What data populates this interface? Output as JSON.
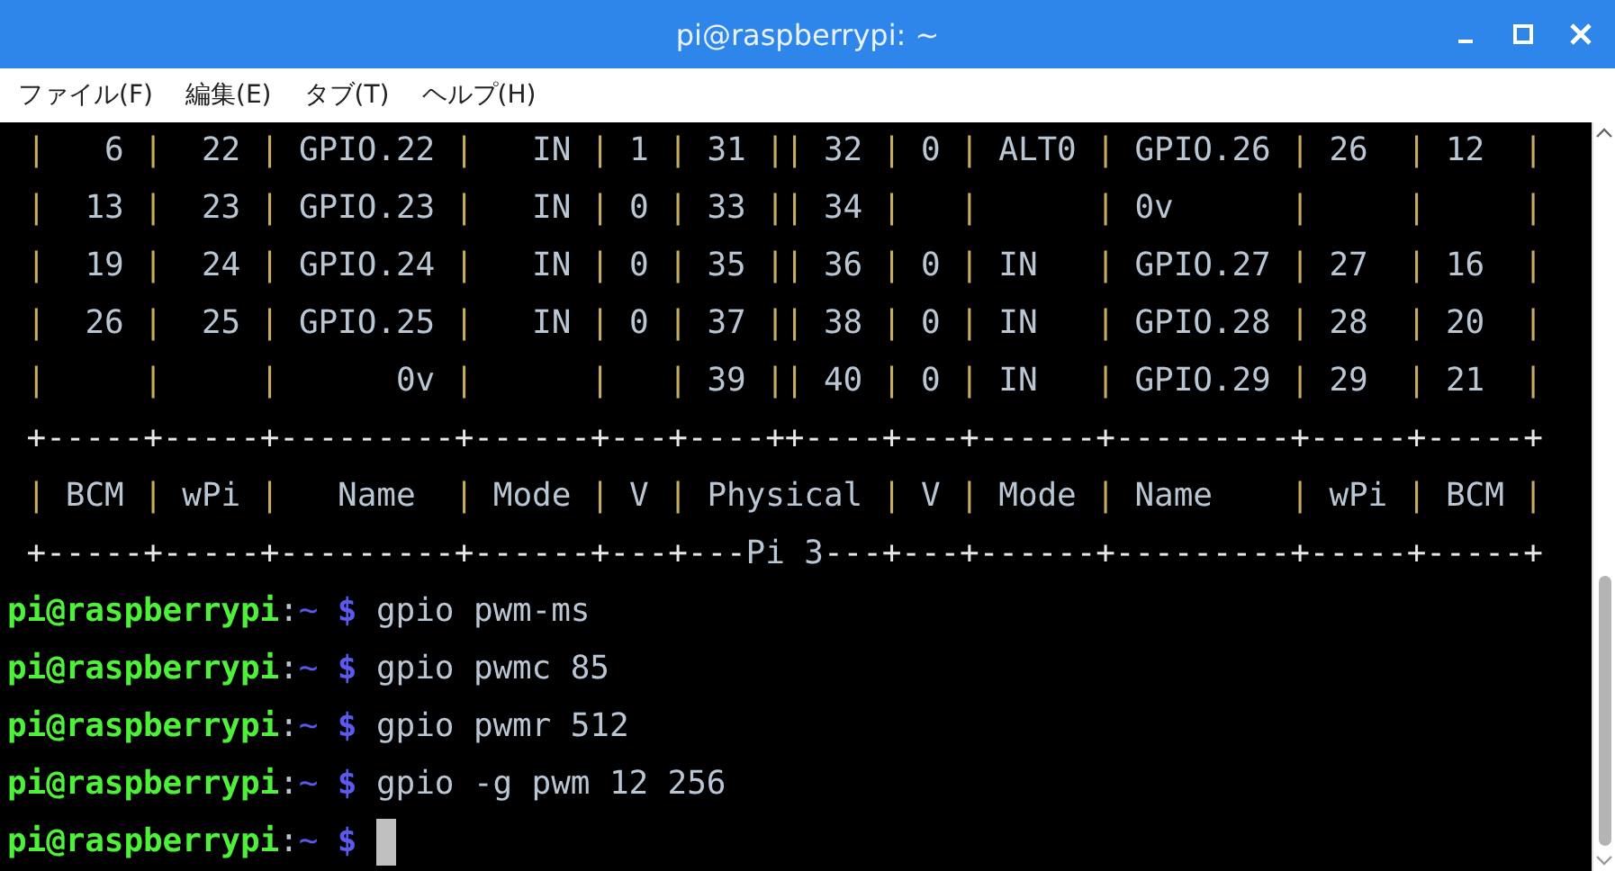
{
  "window": {
    "title": "pi@raspberrypi: ~"
  },
  "menu": [
    "ファイル(F)",
    "編集(E)",
    "タブ(T)",
    "ヘルプ(H)"
  ],
  "terminal": {
    "lines": [
      {
        "kind": "table",
        "text": " |   6 |  22 | GPIO.22 |   IN | 1 | 31 || 32 | 0 | ALT0 | GPIO.26 | 26  | 12  |"
      },
      {
        "kind": "table",
        "text": " |  13 |  23 | GPIO.23 |   IN | 0 | 33 || 34 |   |      | 0v      |     |     |"
      },
      {
        "kind": "table",
        "text": " |  19 |  24 | GPIO.24 |   IN | 0 | 35 || 36 | 0 | IN   | GPIO.27 | 27  | 16  |"
      },
      {
        "kind": "table",
        "text": " |  26 |  25 | GPIO.25 |   IN | 0 | 37 || 38 | 0 | IN   | GPIO.28 | 28  | 20  |"
      },
      {
        "kind": "table",
        "text": " |     |     |      0v |      |   | 39 || 40 | 0 | IN   | GPIO.29 | 29  | 21  |"
      },
      {
        "kind": "table",
        "text": " +-----+-----+---------+------+---+----++----+---+------+---------+-----+-----+"
      },
      {
        "kind": "table",
        "text": " | BCM | wPi |   Name  | Mode | V | Physical | V | Mode | Name    | wPi | BCM |"
      },
      {
        "kind": "table",
        "text": " +-----+-----+---------+------+---+---Pi 3---+---+------+---------+-----+-----+"
      },
      {
        "kind": "prompt",
        "user": "pi@raspberrypi",
        "sep": ":",
        "path": "~",
        "symbol": "$",
        "command": "gpio pwm-ms"
      },
      {
        "kind": "prompt",
        "user": "pi@raspberrypi",
        "sep": ":",
        "path": "~",
        "symbol": "$",
        "command": "gpio pwmc 85"
      },
      {
        "kind": "prompt",
        "user": "pi@raspberrypi",
        "sep": ":",
        "path": "~",
        "symbol": "$",
        "command": "gpio pwmr 512"
      },
      {
        "kind": "prompt",
        "user": "pi@raspberrypi",
        "sep": ":",
        "path": "~",
        "symbol": "$",
        "command": "gpio -g pwm 12 256"
      },
      {
        "kind": "prompt",
        "user": "pi@raspberrypi",
        "sep": ":",
        "path": "~",
        "symbol": "$",
        "cursor": true
      }
    ]
  }
}
